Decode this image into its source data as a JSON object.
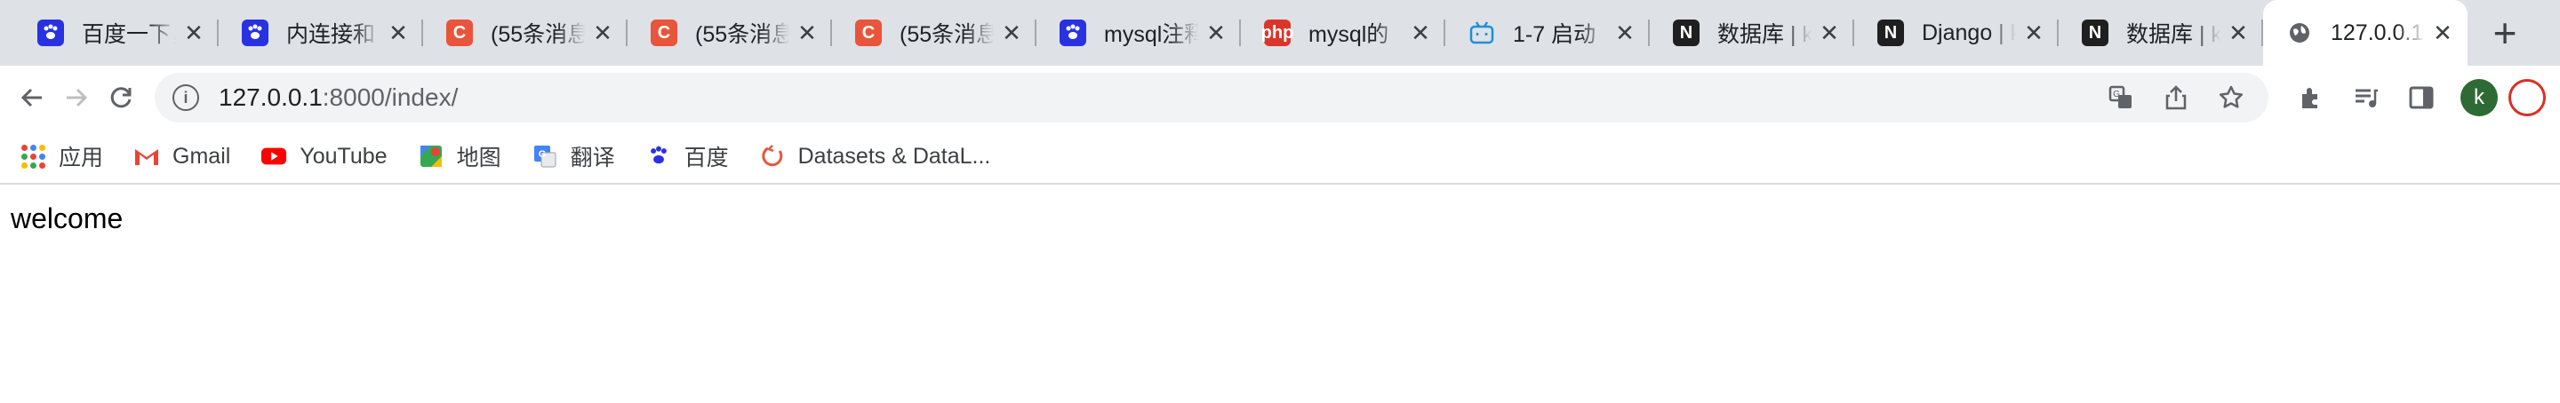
{
  "tabs": [
    {
      "title": "百度一下，",
      "favicon": "baidu-paw-icon"
    },
    {
      "title": "内连接和",
      "favicon": "baidu-paw-icon"
    },
    {
      "title": "(55条消息",
      "favicon": "csdn-c-icon"
    },
    {
      "title": "(55条消息",
      "favicon": "csdn-c-icon"
    },
    {
      "title": "(55条消息",
      "favicon": "csdn-c-icon"
    },
    {
      "title": "mysql注释",
      "favicon": "baidu-paw-icon"
    },
    {
      "title": "mysql的",
      "favicon": "php-icon"
    },
    {
      "title": "1-7 启动",
      "favicon": "bilibili-tv-icon"
    },
    {
      "title": "数据库 | k",
      "favicon": "notion-n-icon"
    },
    {
      "title": "Django | k",
      "favicon": "notion-n-icon"
    },
    {
      "title": "数据库 | k",
      "favicon": "notion-n-icon"
    },
    {
      "title": "127.0.0.1",
      "favicon": "globe-icon",
      "active": true
    }
  ],
  "newtab_label": "+",
  "address": {
    "host": "127.0.0.1",
    "path": ":8000/index/"
  },
  "bookmarks": [
    {
      "label": "应用",
      "icon": "apps-grid-icon"
    },
    {
      "label": "Gmail",
      "icon": "gmail-icon"
    },
    {
      "label": "YouTube",
      "icon": "youtube-icon"
    },
    {
      "label": "地图",
      "icon": "maps-icon"
    },
    {
      "label": "翻译",
      "icon": "translate-icon"
    },
    {
      "label": "百度",
      "icon": "baidu-paw-icon"
    },
    {
      "label": "Datasets & DataL...",
      "icon": "datasets-icon"
    }
  ],
  "profile_initial": "k",
  "page": {
    "text": "welcome"
  },
  "colors": {
    "tabstrip_bg": "#dee1e6",
    "omnibox_bg": "#f1f3f4",
    "baidu_blue": "#2932e1",
    "csdn_red": "#e8553b",
    "avatar_green": "#2e6b34"
  }
}
